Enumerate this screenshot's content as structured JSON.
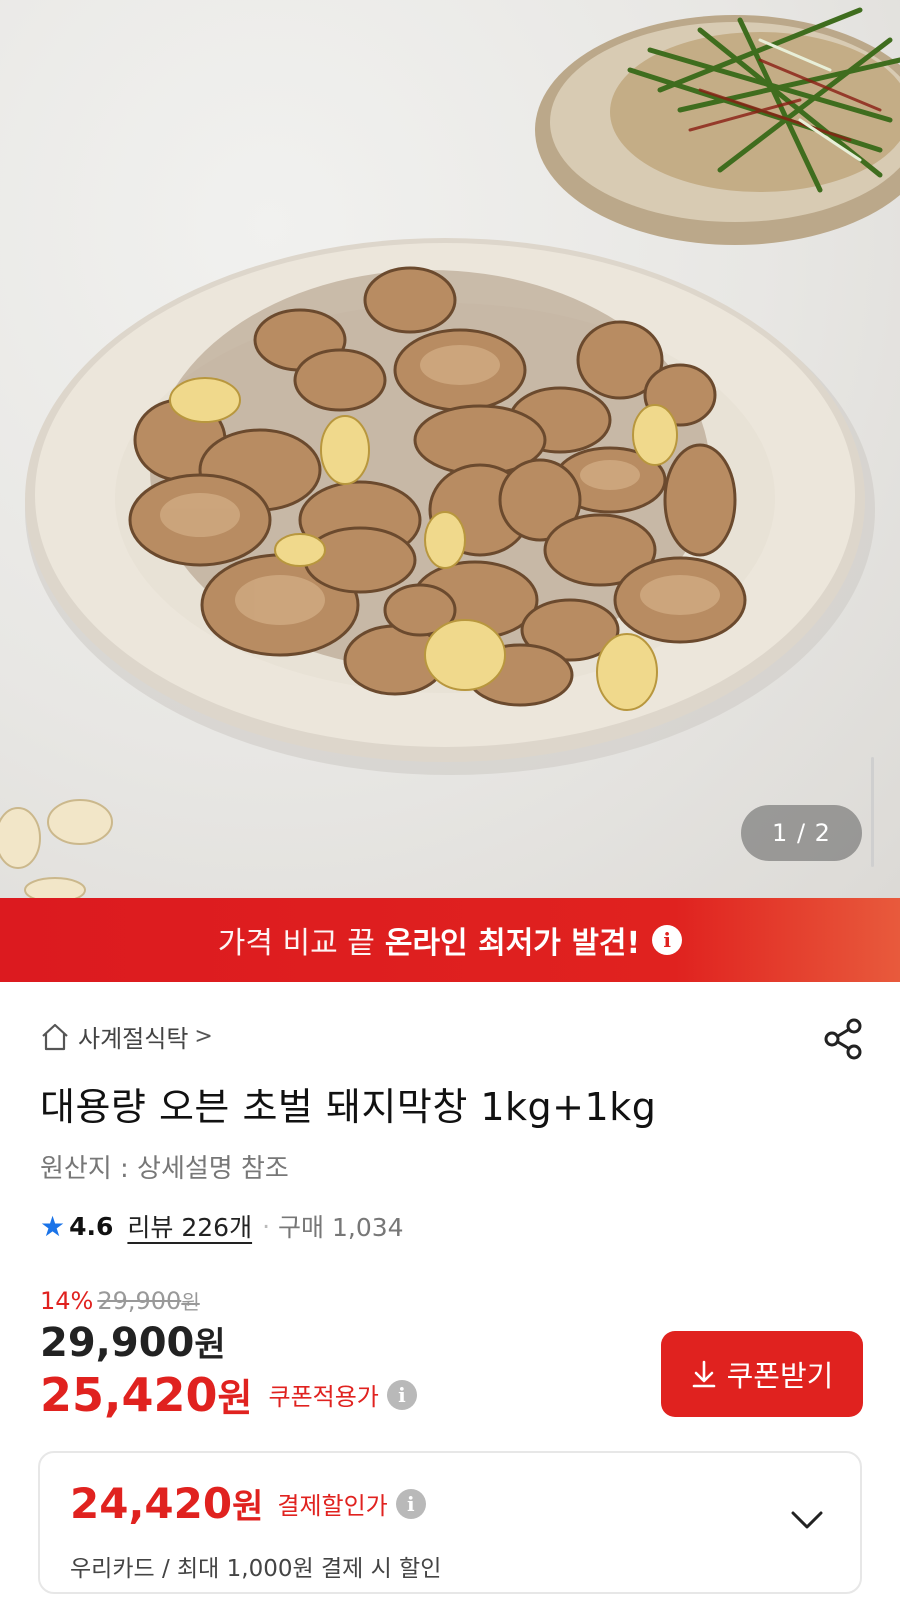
{
  "hero": {
    "pager": "1 / 2"
  },
  "promo": {
    "text_light": "가격 비교 끝",
    "text_bold": "온라인 최저가 발견!",
    "info_icon": "info-icon"
  },
  "product": {
    "breadcrumb": "사계절식탁",
    "breadcrumb_chevron": ">",
    "title": "대용량 오븐 초벌 돼지막창 1kg+1kg",
    "origin": "원산지 : 상세설명 참조",
    "rating": {
      "star": "★",
      "score": "4.6",
      "reviews": "리뷰 226개",
      "dot": "·",
      "purchases": "구매 1,034"
    },
    "price": {
      "discount_rate": "14%",
      "original": "29,900",
      "original_unit": "원",
      "sale": "29,900",
      "sale_unit": "원",
      "coupon_price": "25,420",
      "coupon_unit": "원",
      "coupon_label": "쿠폰적용가",
      "coupon_button": "쿠폰받기"
    },
    "payment": {
      "price": "24,420",
      "unit": "원",
      "label": "결제할인가",
      "detail": "우리카드 / 최대 1,000원 결제 시 할인"
    }
  },
  "icons": {
    "home": "home-icon",
    "share": "share-icon",
    "download": "download-icon",
    "chevron": "chevron-down-icon"
  },
  "colors": {
    "accent": "#e0221f",
    "star": "#1a73e8"
  }
}
